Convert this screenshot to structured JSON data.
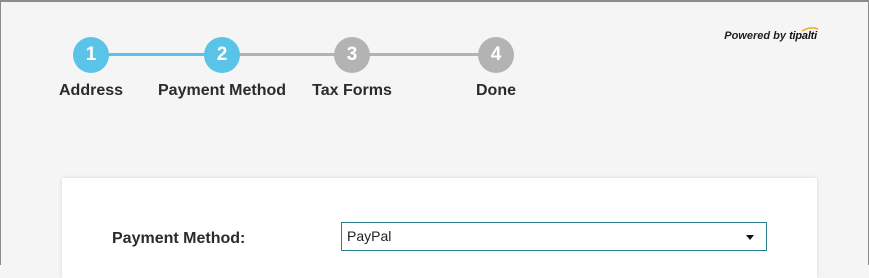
{
  "stepper": {
    "steps": [
      {
        "number": "1",
        "label": "Address",
        "status": "completed"
      },
      {
        "number": "2",
        "label": "Payment Method",
        "status": "current"
      },
      {
        "number": "3",
        "label": "Tax Forms",
        "status": "upcoming"
      },
      {
        "number": "4",
        "label": "Done",
        "status": "upcoming"
      }
    ],
    "colors": {
      "active": "#5ac3e8",
      "inactive": "#b3b3b3"
    }
  },
  "branding": {
    "powered_by": "Powered by",
    "logo_text": "tipalti",
    "logo_accent_color": "#f5a623"
  },
  "form": {
    "payment_method": {
      "label": "Payment Method:",
      "value": "PayPal",
      "icon": "chevron-down-icon"
    }
  }
}
